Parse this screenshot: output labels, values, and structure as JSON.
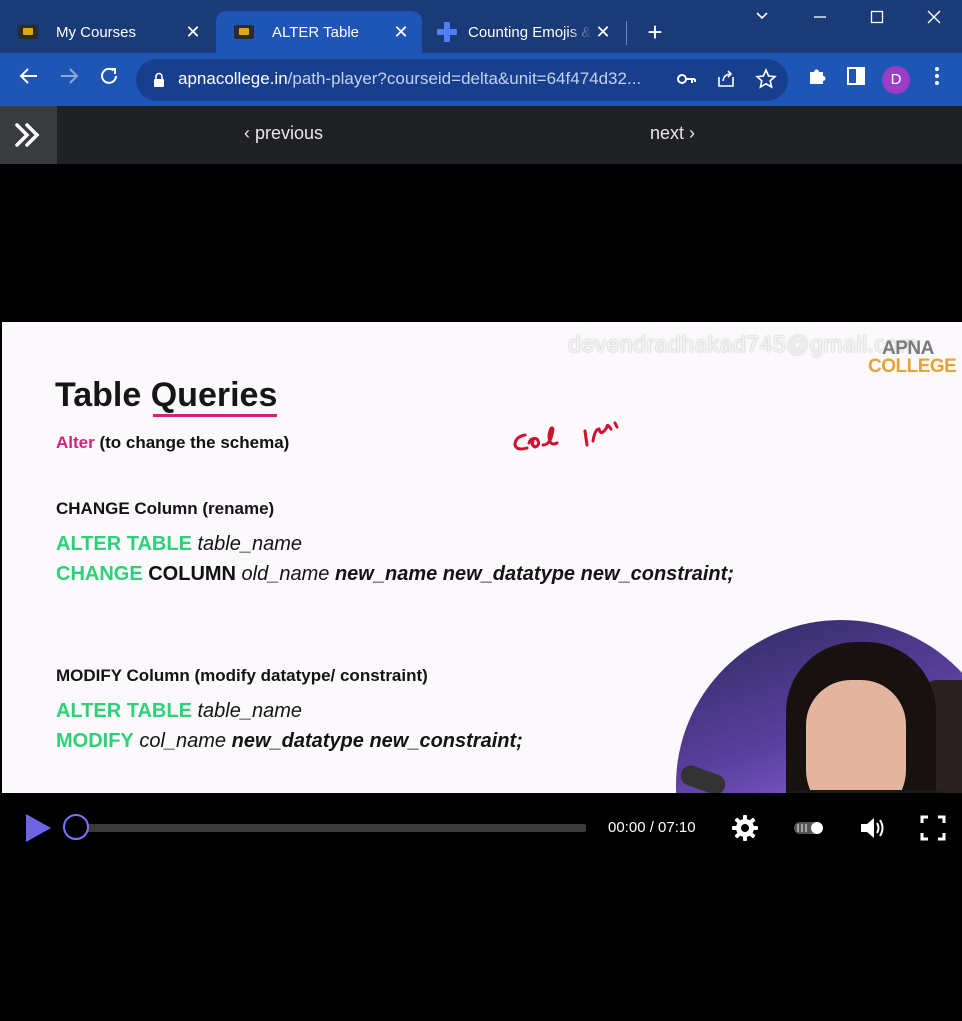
{
  "browser": {
    "tabs": [
      {
        "title": "My Courses",
        "close": "✕"
      },
      {
        "title": "ALTER Table",
        "close": "✕"
      },
      {
        "title": "Counting Emojis &",
        "close": "✕"
      }
    ],
    "new_tab": "+",
    "window_controls": {
      "dropdown": "⌄",
      "minimize": "—",
      "maximize": "☐",
      "close": "✕"
    },
    "url_host": "apnacollege.in",
    "url_path": "/path-player?courseid=delta&unit=64f474d32...",
    "profile_initial": "D"
  },
  "course_nav": {
    "previous": "previous",
    "next": "next"
  },
  "slide": {
    "watermark": "devendradhakad745@gmail.com",
    "logo_top": "APNA",
    "logo_bottom": "COLLEGE",
    "title_plain": "Table ",
    "title_underlined": "Queries",
    "alter_keyword": "Alter",
    "alter_desc": " (to change the schema)",
    "change_heading": "CHANGE Column (rename)",
    "change_line1_kw": "ALTER TABLE",
    "change_line1_it": " table_name",
    "change_line2_kw": "CHANGE",
    "change_line2_bk": " COLUMN",
    "change_line2_it": " old_name",
    "change_line2_bi": " new_name new_datatype new_constraint;",
    "modify_heading": "MODIFY Column (modify datatype/ constraint)",
    "modify_line1_kw": "ALTER TABLE",
    "modify_line1_it": " table_name",
    "modify_line2_kw": "MODIFY",
    "modify_line2_it": " col_name",
    "modify_line2_bi": " new_datatype new_constraint;"
  },
  "player": {
    "time": "00:00 / 07:10",
    "progress": 0
  },
  "colors": {
    "tabstrip": "#1a3a78",
    "toolbar": "#1f55b5",
    "accent_pink": "#d21f80",
    "accent_green": "#2fd07a",
    "play_purple": "#6d64e8"
  }
}
